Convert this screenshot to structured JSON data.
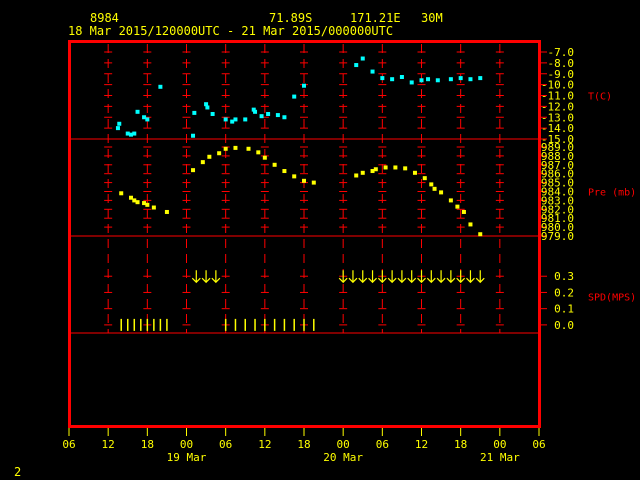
{
  "header": {
    "station": "8984",
    "lat": "71.89S",
    "lon": "171.21E",
    "height": "30M",
    "period": "18 Mar 2015/120000UTC - 21 Mar 2015/000000UTC"
  },
  "page_number": "2",
  "colors": {
    "frame": "#ff0000",
    "ticks": "#ff0000",
    "labels": "#ffff00",
    "temp": "#00ffff",
    "pres": "#ffff00",
    "wind": "#ffff00"
  },
  "chart_data": {
    "type": "scatter",
    "x_axis": {
      "unit": "hours from 18 Mar 06 UTC",
      "range": [
        0,
        72
      ],
      "tick_labels": [
        "06",
        "12",
        "18",
        "00",
        "06",
        "12",
        "18",
        "00",
        "06",
        "12",
        "18",
        "00",
        "06"
      ],
      "day_labels": [
        {
          "text": "19 Mar",
          "x": 18
        },
        {
          "text": "20 Mar",
          "x": 42
        },
        {
          "text": "21 Mar",
          "x": 66
        }
      ]
    },
    "panels": [
      {
        "id": "temp",
        "label": "T(C)",
        "ylim": [
          -15.0,
          -7.0
        ],
        "ticks": [
          "-7.0",
          "-8.0",
          "-9.0",
          "-10.0",
          "-11.0",
          "-12.0",
          "-13.0",
          "-14.0",
          "-15.0"
        ],
        "tick_values": [
          -7,
          -8,
          -9,
          -10,
          -11,
          -12,
          -13,
          -14,
          -15
        ],
        "points": [
          [
            7.5,
            -14.0
          ],
          [
            7.7,
            -13.6
          ],
          [
            9.0,
            -14.5
          ],
          [
            9.5,
            -14.6
          ],
          [
            10.0,
            -14.5
          ],
          [
            10.5,
            -12.5
          ],
          [
            11.5,
            -13.0
          ],
          [
            12.0,
            -13.2
          ],
          [
            14.0,
            -10.2
          ],
          [
            19.0,
            -14.7
          ],
          [
            19.2,
            -12.6
          ],
          [
            21.0,
            -11.8
          ],
          [
            21.2,
            -12.1
          ],
          [
            22.0,
            -12.7
          ],
          [
            24.0,
            -13.2
          ],
          [
            25.0,
            -13.4
          ],
          [
            25.5,
            -13.2
          ],
          [
            27.0,
            -13.2
          ],
          [
            28.3,
            -12.3
          ],
          [
            28.5,
            -12.5
          ],
          [
            29.5,
            -12.9
          ],
          [
            30.5,
            -12.7
          ],
          [
            32.0,
            -12.8
          ],
          [
            33.0,
            -13.0
          ],
          [
            34.5,
            -11.1
          ],
          [
            36.0,
            -10.1
          ],
          [
            44.0,
            -8.2
          ],
          [
            45.0,
            -7.6
          ],
          [
            46.5,
            -8.8
          ],
          [
            48.0,
            -9.4
          ],
          [
            49.5,
            -9.5
          ],
          [
            51.0,
            -9.3
          ],
          [
            52.5,
            -9.8
          ],
          [
            54.0,
            -9.6
          ],
          [
            55.0,
            -9.5
          ],
          [
            56.5,
            -9.6
          ],
          [
            58.5,
            -9.5
          ],
          [
            60.0,
            -9.4
          ],
          [
            61.5,
            -9.5
          ],
          [
            63.0,
            -9.4
          ]
        ]
      },
      {
        "id": "pres",
        "label": "Pre (mb)",
        "ylim": [
          979.0,
          989.0
        ],
        "ticks": [
          "989.0",
          "988.0",
          "987.0",
          "986.0",
          "985.0",
          "984.0",
          "983.0",
          "982.0",
          "981.0",
          "980.0",
          "979.0"
        ],
        "tick_values": [
          989,
          988,
          987,
          986,
          985,
          984,
          983,
          982,
          981,
          980,
          979
        ],
        "points": [
          [
            8.0,
            983.8
          ],
          [
            9.5,
            983.3
          ],
          [
            10.0,
            983.0
          ],
          [
            10.5,
            982.8
          ],
          [
            11.5,
            982.7
          ],
          [
            12.0,
            982.5
          ],
          [
            13.0,
            982.2
          ],
          [
            15.0,
            981.7
          ],
          [
            19.0,
            986.4
          ],
          [
            20.5,
            987.3
          ],
          [
            21.5,
            987.9
          ],
          [
            23.0,
            988.3
          ],
          [
            24.0,
            988.8
          ],
          [
            25.5,
            988.9
          ],
          [
            27.5,
            988.8
          ],
          [
            29.0,
            988.4
          ],
          [
            30.0,
            987.8
          ],
          [
            31.5,
            987.0
          ],
          [
            33.0,
            986.3
          ],
          [
            34.5,
            985.7
          ],
          [
            36.0,
            985.2
          ],
          [
            37.5,
            985.0
          ],
          [
            44.0,
            985.8
          ],
          [
            45.0,
            986.1
          ],
          [
            46.5,
            986.3
          ],
          [
            47.0,
            986.5
          ],
          [
            48.5,
            986.7
          ],
          [
            50.0,
            986.7
          ],
          [
            51.5,
            986.6
          ],
          [
            53.0,
            986.1
          ],
          [
            54.5,
            985.5
          ],
          [
            55.5,
            984.8
          ],
          [
            56.0,
            984.3
          ],
          [
            57.0,
            983.9
          ],
          [
            58.5,
            983.0
          ],
          [
            59.5,
            982.3
          ],
          [
            60.5,
            981.7
          ],
          [
            61.5,
            980.3
          ],
          [
            63.0,
            979.2
          ]
        ]
      },
      {
        "id": "wind",
        "label": "SPD(MPS)",
        "ylim": [
          -0.05,
          0.4
        ],
        "ticks": [
          "0.3",
          "0.2",
          "0.1",
          "0.0"
        ],
        "tick_values": [
          0.3,
          0.2,
          0.1,
          0.0
        ],
        "arrow_level": 0.3,
        "arrows_x": [
          19.5,
          21,
          22.5,
          42,
          43.5,
          45,
          46.5,
          48,
          49.5,
          51,
          52.5,
          54,
          55.5,
          57,
          58.5,
          60,
          61.5,
          63
        ],
        "calm_level": 0.0,
        "calm_marks_x": [
          8,
          9,
          10,
          11,
          12,
          13,
          14,
          15,
          24,
          25.5,
          27,
          28.5,
          30,
          31.5,
          33,
          34.5,
          36,
          37.5
        ]
      }
    ]
  }
}
